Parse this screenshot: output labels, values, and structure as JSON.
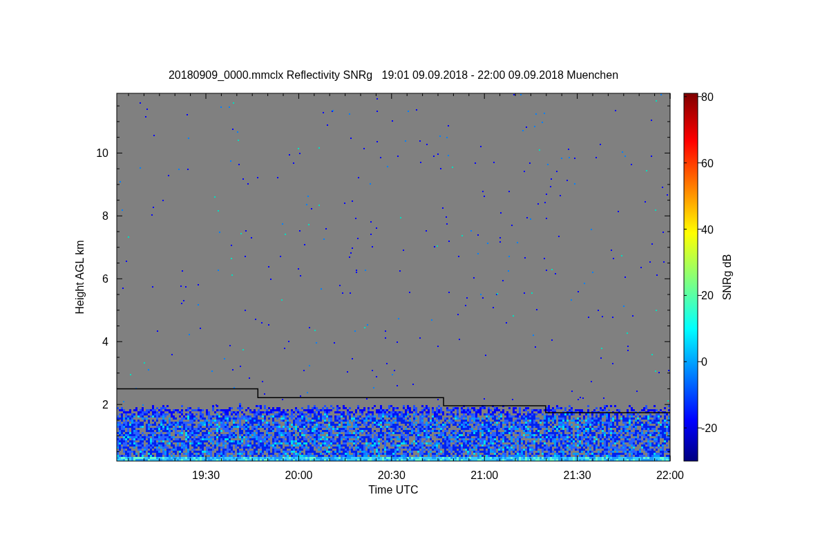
{
  "title": "20180909_0000.mmclx Reflectivity SNRg   19:01 09.09.2018 - 22:00 09.09.2018 Muenchen",
  "chart_data": {
    "type": "line",
    "xlabel": "Time UTC",
    "ylabel": "Height AGL km",
    "x": [
      19.02,
      19.78,
      19.78,
      20.78,
      20.78,
      21.33,
      21.33,
      22.0
    ],
    "series": [
      {
        "color": "#000000",
        "values": [
          2.5,
          2.5,
          2.22,
          2.22,
          1.96,
          1.96,
          1.74,
          1.74
        ]
      }
    ],
    "xlim": [
      19.02,
      22.0
    ],
    "ylim": [
      0.2,
      11.9
    ],
    "xticks": [
      {
        "value": 19.5,
        "label": "19:30"
      },
      {
        "value": 20.0,
        "label": "20:00"
      },
      {
        "value": 20.5,
        "label": "20:30"
      },
      {
        "value": 21.0,
        "label": "21:00"
      },
      {
        "value": 21.5,
        "label": "21:30"
      },
      {
        "value": 22.0,
        "label": "22:00"
      }
    ],
    "yticks": [
      2,
      4,
      6,
      8,
      10
    ]
  },
  "colorbar": {
    "label": "SNRg dB",
    "ticks": [
      "80",
      "60",
      "40",
      "20",
      "0",
      "-20"
    ]
  }
}
